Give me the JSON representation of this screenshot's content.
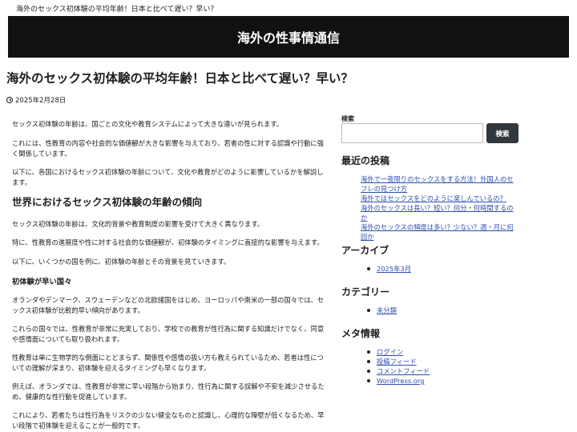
{
  "topbar": {
    "text": "海外のセックス初体験の平均年齢！日本と比べて遅い？早い？"
  },
  "header": {
    "site_title": "海外の性事情通信"
  },
  "post": {
    "title": "海外のセックス初体験の平均年齢！日本と比べて遅い？早い？",
    "date": "2025年2月28日",
    "p1": "セックス初体験の年齢は、国ごとの文化や教育システムによって大きな違いが見られます。",
    "p2": "これには、性教育の内容や社会的な価値観が大きな影響を与えており、若者の性に対する認識や行動に強く関係しています。",
    "p3": "以下に、各国におけるセックス初体験の年齢について、文化や教育がどのように影響しているかを解説します。",
    "h2": "世界におけるセックス初体験の年齢の傾向",
    "p4": "セックス初体験の年齢は、文化的背景や教育制度の影響を受けて大きく異なります。",
    "p5": "特に、性教育の進展度や性に対する社会的な価値観が、初体験のタイミングに直接的な影響を与えます。",
    "p6": "以下に、いくつかの国を例に、初体験の年齢とその背景を見ていきます。",
    "h3": "初体験が早い国々",
    "p7": "オランダやデンマーク、スウェーデンなどの北欧諸国をはじめ、ヨーロッパや南米の一部の国々では、セックス初体験が比較的早い傾向があります。",
    "p8": "これらの国々では、性教育が非常に充実しており、学校での教育が性行為に関する知識だけでなく、同意や感情面についても取り扱われます。",
    "p9": "性教育は単に生物学的な側面にとどまらず、関係性や感情の扱い方も教えられているため、若者は性についての理解が深まり、初体験を迎えるタイミングも早くなります。",
    "p10": "例えば、オランダでは、性教育が非常に早い段階から始まり、性行為に関する誤解や不安を減少させるため、健康的な性行動を促進しています。",
    "p11": "これにより、若者たちは性行為をリスクの少ない健全なものと認識し、心理的な障壁が低くなるため、早い段階で初体験を迎えることが一般的です。"
  },
  "sidebar": {
    "search_label": "検索",
    "search_value": "",
    "search_button": "検索",
    "recent_title": "最近の投稿",
    "recent": [
      "海外で一夜限りのセックスをする方法！外国人のセフレの見つけ方",
      "海外ではセックスをどのように楽しんでいるの？",
      "海外のセックスは長い？短い？何分・何時間するのか",
      "海外のセックスの頻度は多い？少ない？週・月に何回か"
    ],
    "archive_title": "アーカイブ",
    "archives": [
      "2025年3月"
    ],
    "category_title": "カテゴリー",
    "categories": [
      "未分類"
    ],
    "meta_title": "メタ情報",
    "meta": [
      "ログイン",
      "投稿フィード",
      "コメントフィード",
      "WordPress.org"
    ]
  }
}
